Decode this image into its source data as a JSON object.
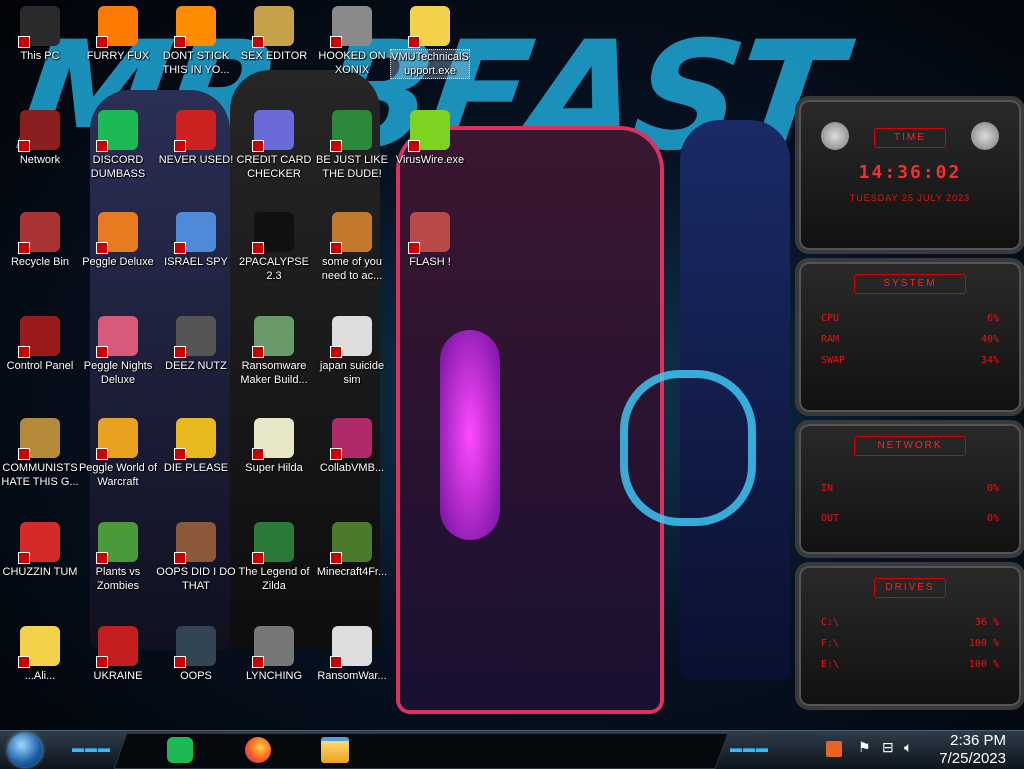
{
  "wallpaper": {
    "text": "MR BEAST"
  },
  "desktop_icons": [
    {
      "label": "This PC",
      "icon": "computer-icon",
      "color": "#2b2b2b"
    },
    {
      "label": "FURRY FUX",
      "icon": "firefox-icon",
      "color": "#ff7a00"
    },
    {
      "label": "DONT STICK THIS IN YO...",
      "icon": "vlc-cone-icon",
      "color": "#ff8c00"
    },
    {
      "label": "SEX EDITOR",
      "icon": "xd-editor-icon",
      "color": "#c7a04a"
    },
    {
      "label": "HOOKED ON XONIX",
      "icon": "xonix-game-icon",
      "color": "#8a8a8a"
    },
    {
      "label": "VMUTechnicalSupport.exe",
      "icon": "cartoon-girl-icon",
      "color": "#f3d24a"
    },
    {
      "label": "Network",
      "icon": "network-icon",
      "color": "#8b1e1e"
    },
    {
      "label": "DISCORD DUMBASS",
      "icon": "discord-icon",
      "color": "#1db954"
    },
    {
      "label": "NEVER USED!",
      "icon": "dev-icon",
      "color": "#cc2222"
    },
    {
      "label": "CREDIT CARD CHECKER",
      "icon": "credit-card-icon",
      "color": "#6a6ad8"
    },
    {
      "label": "BE JUST LIKE THE DUDE!",
      "icon": "santa-icon",
      "color": "#2a8a3a"
    },
    {
      "label": "VirusWire.exe",
      "icon": "lime-icon",
      "color": "#7ed321"
    },
    {
      "label": "Recycle Bin",
      "icon": "recycle-bin-icon",
      "color": "#a33"
    },
    {
      "label": "Peggle Deluxe",
      "icon": "peggle-icon",
      "color": "#e87a1f"
    },
    {
      "label": "ISRAEL SPY",
      "icon": "spy-folder-icon",
      "color": "#4f8ad8"
    },
    {
      "label": "2PACALYPSE 2.3",
      "icon": "terminal-icon",
      "color": "#111111"
    },
    {
      "label": "some of you need to ac...",
      "icon": "beaver-icon",
      "color": "#c27a2a"
    },
    {
      "label": "FLASH !",
      "icon": "flash-icon",
      "color": "#b94a4a"
    },
    {
      "label": "Control Panel",
      "icon": "control-panel-icon",
      "color": "#9b1b1b"
    },
    {
      "label": "Peggle Nights Deluxe",
      "icon": "peggle-icon",
      "color": "#d85a7a"
    },
    {
      "label": "DEEZ NUTZ",
      "icon": "stacked-windows-icon",
      "color": "#555555"
    },
    {
      "label": "Ransomware Maker Build...",
      "icon": "window-app-icon",
      "color": "#6a9a6a"
    },
    {
      "label": "japan suicide sim",
      "icon": "document-icon",
      "color": "#dddddd"
    },
    {
      "label": "COMMUNISTS HATE THIS G...",
      "icon": "money-bag-icon",
      "color": "#b58a3a"
    },
    {
      "label": "Peggle World of Warcraft",
      "icon": "peggle-icon",
      "color": "#e8a21f"
    },
    {
      "label": "DIE PLEASE",
      "icon": "de-icon",
      "color": "#e8b81f"
    },
    {
      "label": "Super Hilda",
      "icon": "pixel-game-icon",
      "color": "#e8e8c8"
    },
    {
      "label": "CollabVMB...",
      "icon": "collab-vm-icon",
      "color": "#b02a6a"
    },
    {
      "label": "CHUZZIN TUM",
      "icon": "chuzzle-icon",
      "color": "#d42a2a"
    },
    {
      "label": "Plants vs Zombies",
      "icon": "plant-icon",
      "color": "#4a9a3a"
    },
    {
      "label": "OOPS DID I DO THAT",
      "icon": "portrait-icon",
      "color": "#8a5a3a"
    },
    {
      "label": "The Legend of Zilda",
      "icon": "zelda-icon",
      "color": "#2a7a3a"
    },
    {
      "label": "Minecraft4Fr...",
      "icon": "minecraft-grass-icon",
      "color": "#4a7a2a"
    },
    {
      "label": "...Ali...",
      "icon": "cartoon-girl-icon",
      "color": "#f3d24a"
    },
    {
      "label": "UKRAINE",
      "icon": "radiation-icon",
      "color": "#c41e1e"
    },
    {
      "label": "OOPS",
      "icon": "monitor-icon",
      "color": "#334455"
    },
    {
      "label": "LYNCHING",
      "icon": "noose-icon",
      "color": "#777777"
    },
    {
      "label": "RansomWar...",
      "icon": "skull-icon",
      "color": "#dddddd"
    }
  ],
  "gadgets": {
    "time": {
      "title": "TIME",
      "clock": "14:36:02",
      "date": "TUESDAY 25 JULY 2023"
    },
    "system": {
      "title": "SYSTEM",
      "rows": [
        {
          "label": "CPU",
          "value": "6%"
        },
        {
          "label": "RAM",
          "value": "40%"
        },
        {
          "label": "SWAP",
          "value": "34%"
        }
      ]
    },
    "network": {
      "title": "NETWORK",
      "rows": [
        {
          "label": "IN",
          "value": "0%"
        },
        {
          "label": "OUT",
          "value": "0%"
        }
      ]
    },
    "drives": {
      "title": "DRIVES",
      "rows": [
        {
          "label": "C:\\",
          "value": "36 %"
        },
        {
          "label": "F:\\",
          "value": "100 %"
        },
        {
          "label": "E:\\",
          "value": "100 %"
        }
      ]
    },
    "accent": "#ff1a1a"
  },
  "taskbar": {
    "start": "start-orb-icon",
    "pinned": [
      {
        "name": "spotify-icon",
        "color": "#1db954"
      },
      {
        "name": "firefox-icon",
        "color": "#ff7a00"
      },
      {
        "name": "file-explorer-icon",
        "color": "#e8b81f"
      }
    ],
    "tray_icons": [
      "tray-app-icon",
      "flag-icon",
      "network-icon",
      "volume-icon"
    ],
    "time": "2:36 PM",
    "date": "7/25/2023"
  }
}
